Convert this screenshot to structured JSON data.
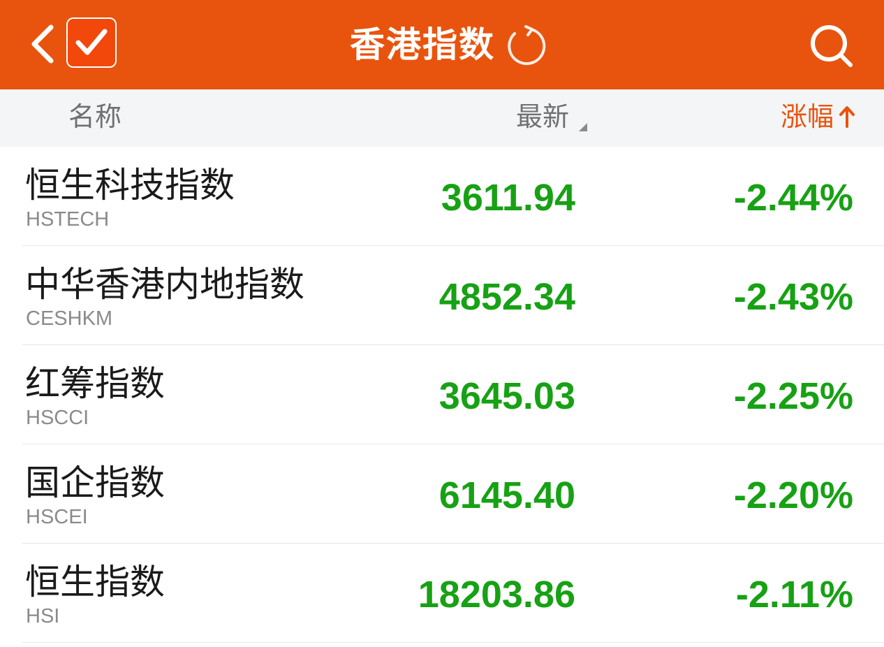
{
  "header": {
    "title": "香港指数",
    "back_icon": "chevron-left-icon",
    "check_icon": "checkmark-icon",
    "refresh_icon": "refresh-icon",
    "search_icon": "search-icon"
  },
  "columns": {
    "name": "名称",
    "latest": "最新",
    "change": "涨幅"
  },
  "rows": [
    {
      "name": "恒生科技指数",
      "code": "HSTECH",
      "price": "3611.94",
      "change": "-2.44%"
    },
    {
      "name": "中华香港内地指数",
      "code": "CESHKM",
      "price": "4852.34",
      "change": "-2.43%"
    },
    {
      "name": "红筹指数",
      "code": "HSCCI",
      "price": "3645.03",
      "change": "-2.25%"
    },
    {
      "name": "国企指数",
      "code": "HSCEI",
      "price": "6145.40",
      "change": "-2.20%"
    },
    {
      "name": "恒生指数",
      "code": "HSI",
      "price": "18203.86",
      "change": "-2.11%"
    }
  ],
  "colors": {
    "brand": "#e8540e",
    "header_bg": "#f4f5f7",
    "down": "#17a114"
  }
}
